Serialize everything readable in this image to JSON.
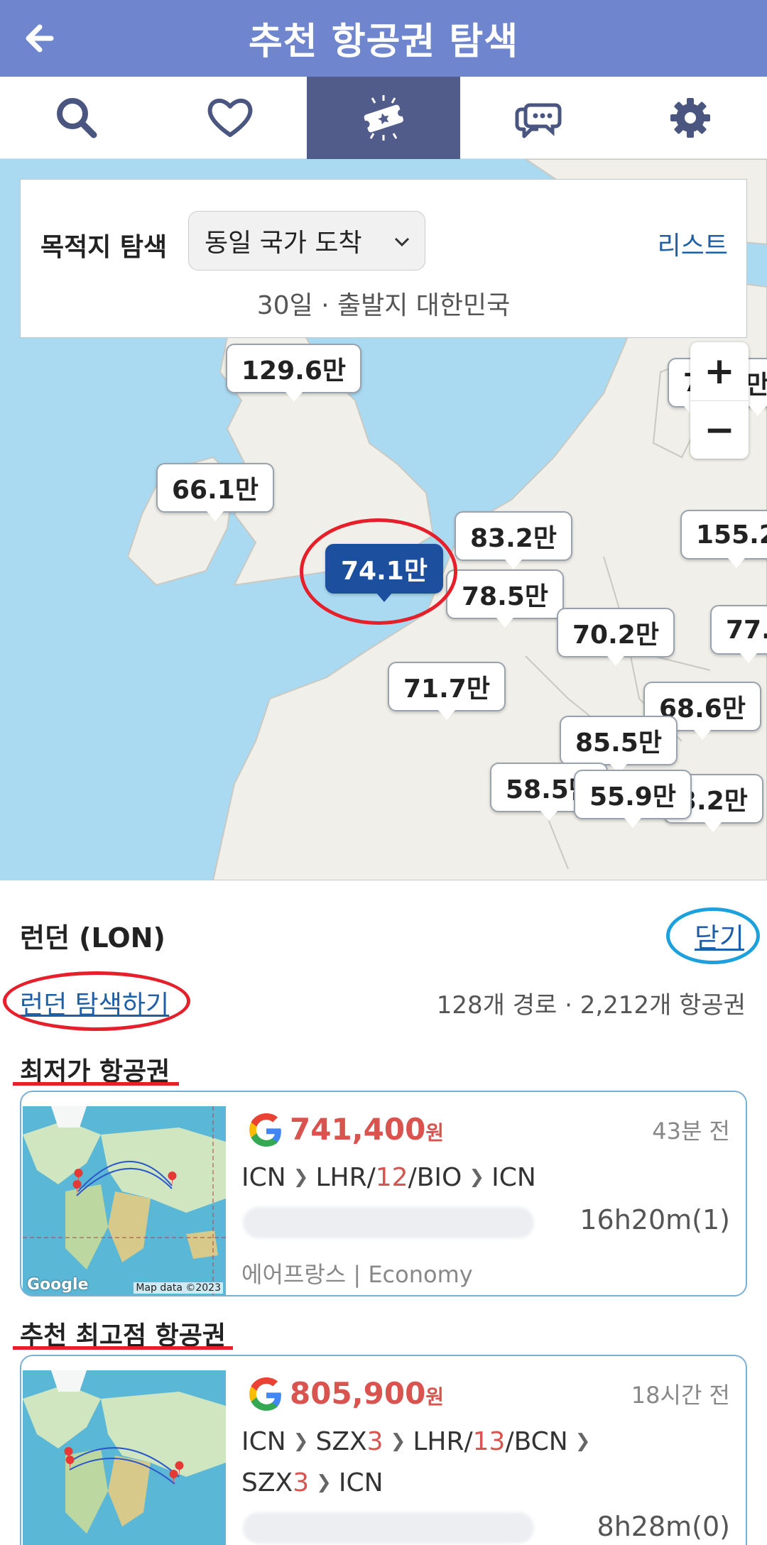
{
  "header": {
    "title": "추천 항공권 탐색",
    "back_icon": "arrow-left-icon"
  },
  "tabs": [
    {
      "icon": "search-icon",
      "active": false
    },
    {
      "icon": "heart-icon",
      "active": false
    },
    {
      "icon": "ticket-star-icon",
      "active": true
    },
    {
      "icon": "chat-bubbles-icon",
      "active": false
    },
    {
      "icon": "gear-icon",
      "active": false
    }
  ],
  "map_panel": {
    "label": "목적지 탐색",
    "selected_option": "동일 국가 도착",
    "list_link": "리스트",
    "subtitle": "30일 · 출발지 대한민국"
  },
  "map_pins": [
    "129.6만",
    "66.1만",
    "74.1만",
    "83.2만",
    "78.5만",
    "70.2만",
    "71.7만",
    "68.6만",
    "85.5만",
    "58.5만",
    "55.9만",
    "3.2만",
    "155.2",
    "77.",
    "7",
    "만"
  ],
  "selected_pin": "74.1만",
  "destination": {
    "city": "런던 (LON)",
    "close_label": "닫기",
    "explore_label": "런던 탐색하기",
    "stats": "128개 경로 · 2,212개 항공권"
  },
  "sections": {
    "cheapest_title": "최저가 항공권",
    "best_title": "추천 최고점 항공권"
  },
  "cards": {
    "cheapest": {
      "price": "741,400",
      "currency": "원",
      "ago": "43분 전",
      "route": [
        "ICN",
        "LHR",
        "12",
        "BIO",
        "ICN"
      ],
      "duration": "16h20m(1)",
      "airline": "에어프랑스 | Economy",
      "google": "Google",
      "map_data": "Map data ©2023"
    },
    "best": {
      "price": "805,900",
      "currency": "원",
      "ago": "18시간 전",
      "route_line1": [
        "ICN",
        "SZX",
        "3",
        "LHR",
        "13",
        "BCN"
      ],
      "route_line2": [
        "SZX",
        "3",
        "ICN"
      ],
      "duration": "8h28m(0)"
    }
  },
  "colors": {
    "header": "#6f86cf",
    "active_tab": "#525c8a",
    "link": "#1f5fa6",
    "price": "#d9534f",
    "selected_pin": "#1d4f9f",
    "annotation_red": "#e5202b",
    "annotation_blue": "#1da1dc"
  }
}
